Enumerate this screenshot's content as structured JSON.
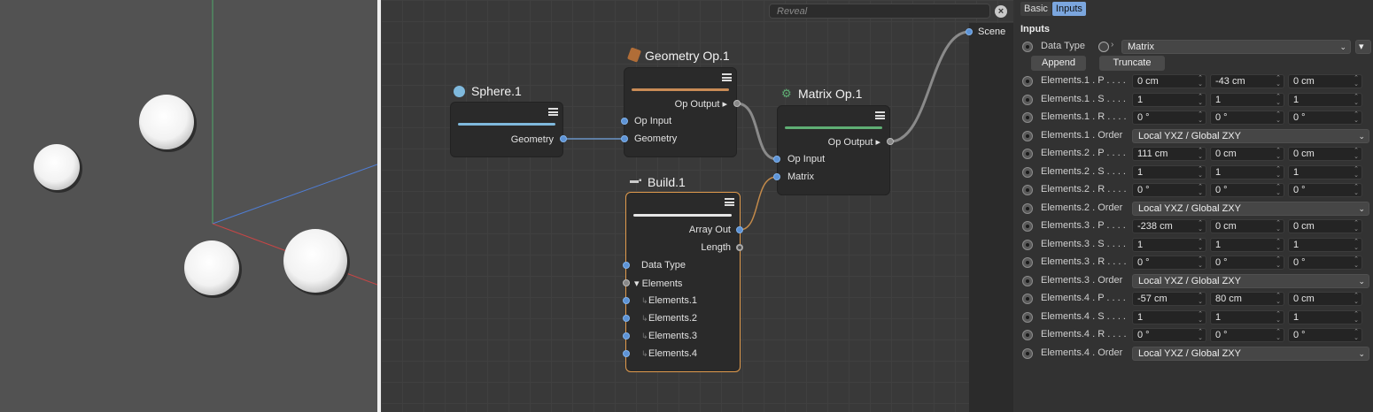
{
  "search": {
    "placeholder": "Reveal",
    "clear": "×"
  },
  "scene": {
    "label": "Scene"
  },
  "nodes": {
    "sphere": {
      "title": "Sphere.1",
      "port_out": "Geometry"
    },
    "geometry_op": {
      "title": "Geometry Op.1",
      "port_out": "Op Output",
      "ports_in": [
        "Op Input",
        "Geometry"
      ]
    },
    "matrix_op": {
      "title": "Matrix Op.1",
      "port_out": "Op Output",
      "ports_in": [
        "Op Input",
        "Matrix"
      ]
    },
    "build": {
      "title": "Build.1",
      "ports_out": [
        "Array Out",
        "Length"
      ],
      "ports_in": [
        "Data Type",
        "Elements",
        "Elements.1",
        "Elements.2",
        "Elements.3",
        "Elements.4"
      ]
    }
  },
  "panel": {
    "tabs": [
      "Basic",
      "Inputs"
    ],
    "active_tab": "Inputs",
    "section_title": "Inputs",
    "data_type": {
      "label": "Data Type",
      "value": "Matrix",
      "chev": "▾"
    },
    "buttons": {
      "append": "Append",
      "truncate": "Truncate"
    },
    "rows": [
      {
        "label": "Elements.1 . P . . . .",
        "values": [
          "0 cm",
          "-43 cm",
          "0 cm"
        ]
      },
      {
        "label": "Elements.1 . S . . . .",
        "values": [
          "1",
          "1",
          "1"
        ]
      },
      {
        "label": "Elements.1 . R . . . .",
        "values": [
          "0 °",
          "0 °",
          "0 °"
        ]
      },
      {
        "label": "Elements.1 . Order",
        "dropdown": "Local YXZ / Global ZXY"
      },
      {
        "label": "Elements.2 . P . . . .",
        "values": [
          "111 cm",
          "0 cm",
          "0 cm"
        ]
      },
      {
        "label": "Elements.2 . S . . . .",
        "values": [
          "1",
          "1",
          "1"
        ]
      },
      {
        "label": "Elements.2 . R . . . .",
        "values": [
          "0 °",
          "0 °",
          "0 °"
        ]
      },
      {
        "label": "Elements.2 . Order",
        "dropdown": "Local YXZ / Global ZXY"
      },
      {
        "label": "Elements.3 . P . . . .",
        "values": [
          "-238 cm",
          "0 cm",
          "0 cm"
        ]
      },
      {
        "label": "Elements.3 . S . . . .",
        "values": [
          "1",
          "1",
          "1"
        ]
      },
      {
        "label": "Elements.3 . R . . . .",
        "values": [
          "0 °",
          "0 °",
          "0 °"
        ]
      },
      {
        "label": "Elements.3 . Order",
        "dropdown": "Local YXZ / Global ZXY"
      },
      {
        "label": "Elements.4 . P . . . .",
        "values": [
          "-57 cm",
          "80 cm",
          "0 cm"
        ]
      },
      {
        "label": "Elements.4 . S . . . .",
        "values": [
          "1",
          "1",
          "1"
        ]
      },
      {
        "label": "Elements.4 . R . . . .",
        "values": [
          "0 °",
          "0 °",
          "0 °"
        ]
      },
      {
        "label": "Elements.4 . Order",
        "dropdown": "Local YXZ / Global ZXY"
      }
    ]
  },
  "colors": {
    "accent": "#7ba6de",
    "port_blue": "#5d93d6",
    "selection": "#e09a4c",
    "sphere_bar": "#7fb9dd",
    "geometry_bar": "#c98b56",
    "matrix_bar": "#5fae74"
  }
}
